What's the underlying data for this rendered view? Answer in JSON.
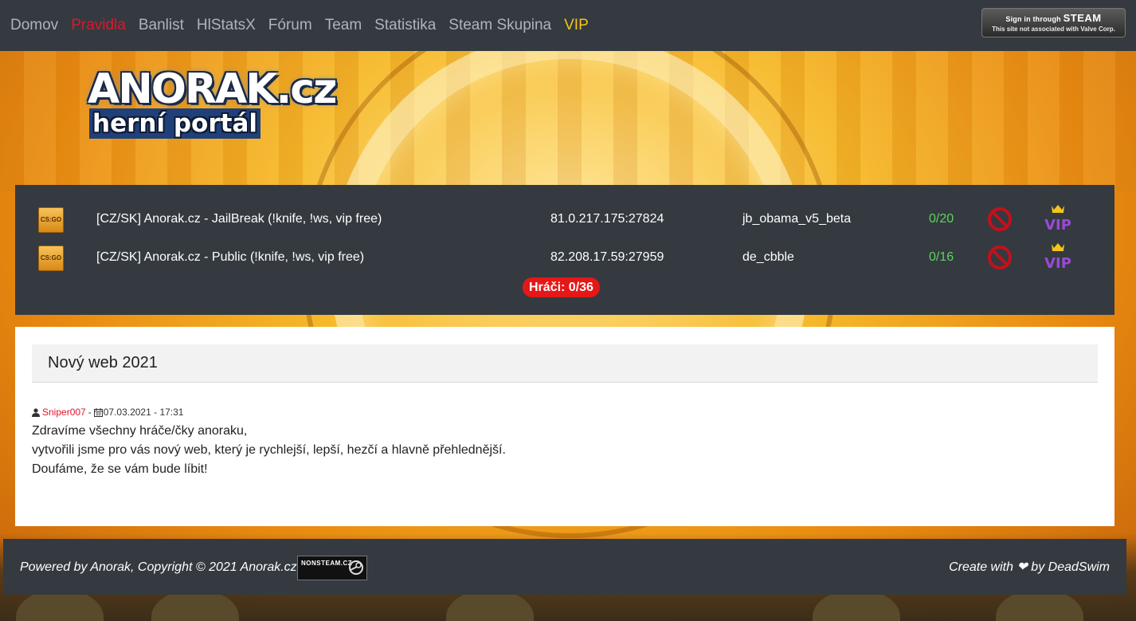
{
  "nav": {
    "items": [
      {
        "label": "Domov",
        "state": "normal"
      },
      {
        "label": "Pravidla",
        "state": "active"
      },
      {
        "label": "Banlist",
        "state": "normal"
      },
      {
        "label": "HlStatsX",
        "state": "normal"
      },
      {
        "label": "Fórum",
        "state": "normal"
      },
      {
        "label": "Team",
        "state": "normal"
      },
      {
        "label": "Statistika",
        "state": "normal"
      },
      {
        "label": "Steam Skupina",
        "state": "normal"
      },
      {
        "label": "VIP",
        "state": "vip"
      }
    ],
    "steam_login": {
      "line1": "Sign in through",
      "brand": "STEAM",
      "line2": "This site not associated with Valve Corp."
    }
  },
  "logo": {
    "main": "ANORAK.cz",
    "sub": "herní portál"
  },
  "servers": {
    "rows": [
      {
        "game_icon": "csgo-icon",
        "game_label": "CS:GO",
        "name": "[CZ/SK] Anorak.cz - JailBreak (!knife, !ws, vip free)",
        "ip": "81.0.217.175:27824",
        "map": "jb_obama_v5_beta",
        "players": "0/20"
      },
      {
        "game_icon": "csgo-icon",
        "game_label": "CS:GO",
        "name": "[CZ/SK] Anorak.cz - Public (!knife, !ws, vip free)",
        "ip": "82.208.17.59:27959",
        "map": "de_cbble",
        "players": "0/16"
      }
    ],
    "total_players": "Hráči: 0/36"
  },
  "news": {
    "title": "Nový web 2021",
    "author": "Sniper007",
    "separator": "-",
    "date": "07.03.2021 - 17:31",
    "body": [
      "Zdravíme všechny hráče/čky anoraku,",
      "vytvořili jsme pro vás nový web, který je rychlejší, lepší, hezčí a hlavně přehlednější.",
      "Doufáme, že se vám bude líbit!"
    ]
  },
  "footer": {
    "left": "Powered by Anorak, Copyright © 2021 Anorak.cz.",
    "badge": "NONSTEAM.CZ",
    "right": "Create with ❤ by DeadSwim"
  },
  "colors": {
    "navbar_bg": "#343a40",
    "nav_text": "#aeb4ba",
    "nav_active": "#e0152c",
    "nav_vip": "#f5c518",
    "players_ok": "#5ed35e",
    "total_badge": "#e51717"
  }
}
